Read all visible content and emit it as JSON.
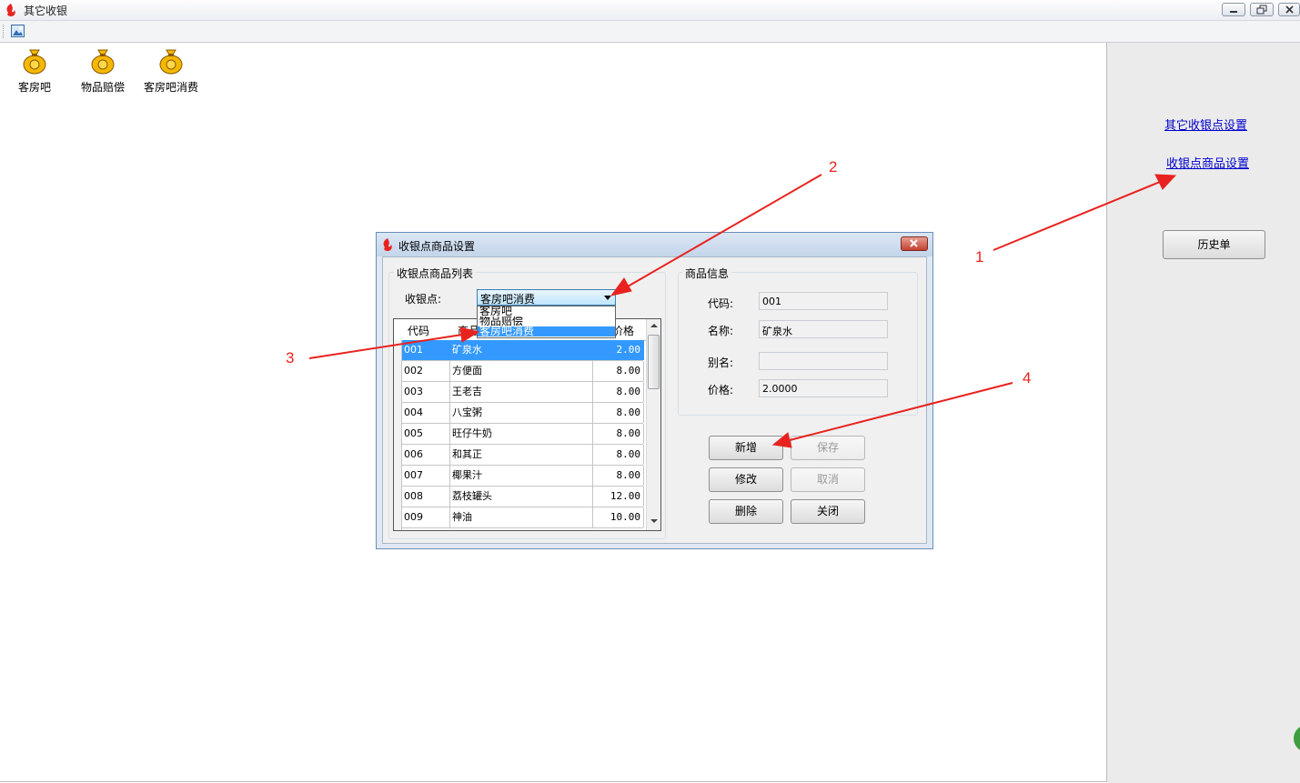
{
  "window": {
    "title": "其它收银"
  },
  "stations": [
    {
      "label": "客房吧"
    },
    {
      "label": "物品赔偿"
    },
    {
      "label": "客房吧消费"
    }
  ],
  "right_panel": {
    "link_other_settings": "其它收银点设置",
    "link_goods_settings": "收银点商品设置",
    "history_button": "历史单"
  },
  "dialog": {
    "title": "收银点商品设置",
    "list_group_title": "收银点商品列表",
    "station_label": "收银点:",
    "station_selected": "客房吧消费",
    "station_options": [
      "客房吧",
      "物品赔偿",
      "客房吧消费"
    ],
    "grid": {
      "headers": [
        "代码",
        "商品",
        "价格"
      ],
      "rows": [
        {
          "code": "001",
          "name": "矿泉水",
          "price": "2.00"
        },
        {
          "code": "002",
          "name": "方便面",
          "price": "8.00"
        },
        {
          "code": "003",
          "name": "王老吉",
          "price": "8.00"
        },
        {
          "code": "004",
          "name": "八宝粥",
          "price": "8.00"
        },
        {
          "code": "005",
          "name": "旺仔牛奶",
          "price": "8.00"
        },
        {
          "code": "006",
          "name": "和其正",
          "price": "8.00"
        },
        {
          "code": "007",
          "name": "椰果汁",
          "price": "8.00"
        },
        {
          "code": "008",
          "name": "荔枝罐头",
          "price": "12.00"
        },
        {
          "code": "009",
          "name": "神油",
          "price": "10.00"
        }
      ]
    },
    "info_group_title": "商品信息",
    "fields": {
      "code_label": "代码:",
      "code_value": "001",
      "name_label": "名称:",
      "name_value": "矿泉水",
      "alias_label": "别名:",
      "alias_value": "",
      "price_label": "价格:",
      "price_value": "2.0000"
    },
    "buttons": {
      "add": "新增",
      "save": "保存",
      "edit": "修改",
      "cancel": "取消",
      "delete": "删除",
      "close": "关闭"
    }
  },
  "annotations": {
    "a1": "1",
    "a2": "2",
    "a3": "3",
    "a4": "4"
  },
  "colors": {
    "accent_select": "#3399ff",
    "link": "#0000cc",
    "annotation": "#e8231f"
  }
}
